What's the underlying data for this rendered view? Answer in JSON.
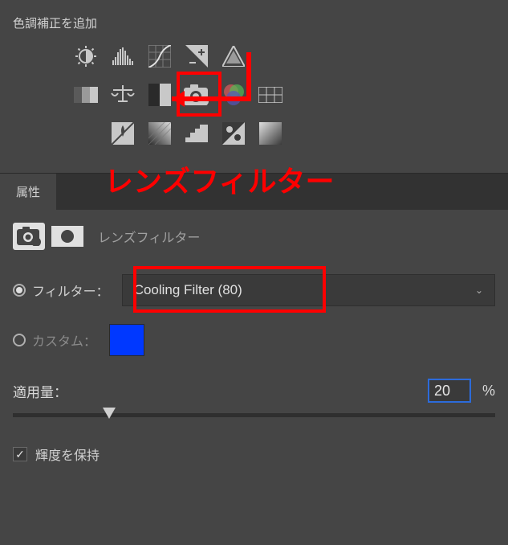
{
  "header": {
    "title": "色調補正を追加"
  },
  "adjustments": {
    "row1": [
      "brightness-contrast",
      "levels",
      "curves",
      "exposure",
      "vibrance"
    ],
    "row2": [
      "black-white",
      "color-balance",
      "threshold",
      "photo-filter",
      "channel-mixer",
      "color-lookup"
    ],
    "row3": [
      "hue-saturation",
      "gradient-map",
      "posterize",
      "invert",
      "selective-color"
    ]
  },
  "annotations": {
    "callout_text": "レンズフィルター"
  },
  "tabs": {
    "active": "属性"
  },
  "properties": {
    "panel_title": "レンズフィルター",
    "filter_label": "フィルター：",
    "filter_selected": "Cooling Filter (80)",
    "filter_mode": "filter",
    "custom_label": "カスタム：",
    "custom_color": "#0038ff",
    "density_label": "適用量：",
    "density_value": "20",
    "density_unit": "%",
    "preserve_lum_label": "輝度を保持",
    "preserve_lum_checked": true
  }
}
